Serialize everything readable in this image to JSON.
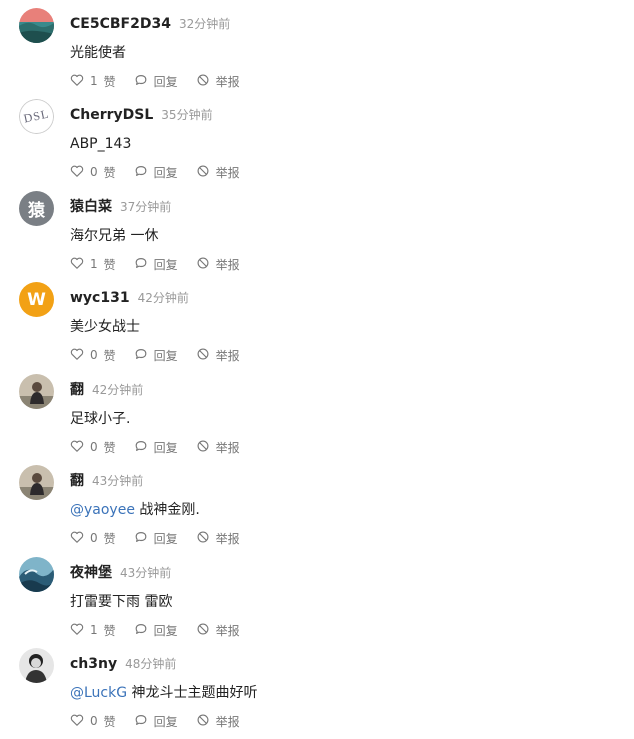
{
  "labels": {
    "like": "赞",
    "reply": "回复",
    "report": "举报"
  },
  "comments": [
    {
      "user": "CE5CBF2D34",
      "time": "32分钟前",
      "mention": "",
      "text": "光能使者",
      "likes": "1",
      "avatar": "landscape"
    },
    {
      "user": "CherryDSL",
      "time": "35分钟前",
      "mention": "",
      "text": "ABP_143",
      "likes": "0",
      "avatar": "dsl"
    },
    {
      "user": "猿白菜",
      "time": "37分钟前",
      "mention": "",
      "text": "海尔兄弟 一休",
      "likes": "1",
      "avatar": "letter",
      "avatar_text": "猿",
      "avatar_color": "#7a7f85"
    },
    {
      "user": "wyc131",
      "time": "42分钟前",
      "mention": "",
      "text": "美少女战士",
      "likes": "0",
      "avatar": "letter",
      "avatar_text": "W",
      "avatar_color": "#f2a115"
    },
    {
      "user": "翻",
      "time": "42分钟前",
      "mention": "",
      "text": "足球小子.",
      "likes": "0",
      "avatar": "photo-person"
    },
    {
      "user": "翻",
      "time": "43分钟前",
      "mention": "@yaoyee",
      "text": "战神金刚.",
      "likes": "0",
      "avatar": "photo-person"
    },
    {
      "user": "夜神堡",
      "time": "43分钟前",
      "mention": "",
      "text": "打雷要下雨 雷欧",
      "likes": "1",
      "avatar": "wave"
    },
    {
      "user": "ch3ny",
      "time": "48分钟前",
      "mention": "@LuckG",
      "text": "神龙斗士主题曲好听",
      "likes": "0",
      "avatar": "bw-person"
    }
  ]
}
